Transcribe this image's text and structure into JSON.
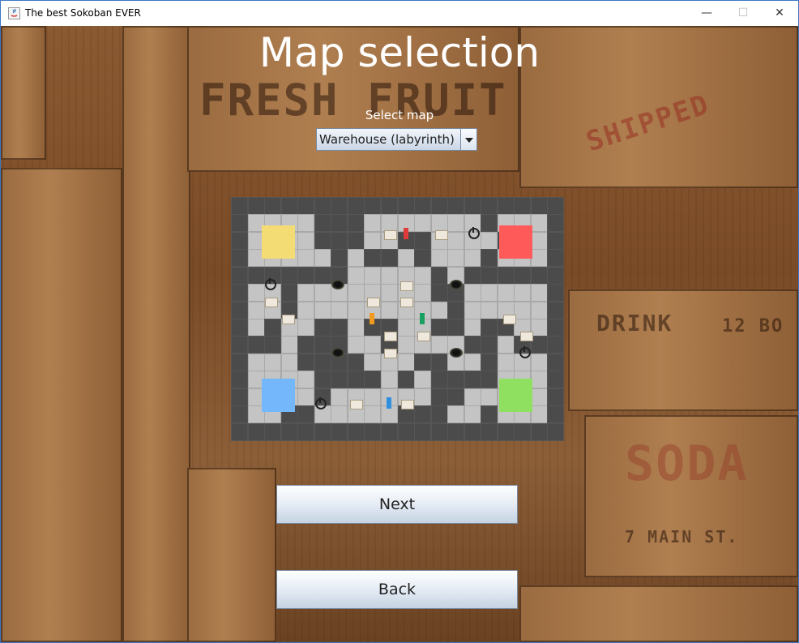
{
  "window": {
    "title": "The best Sokoban EVER"
  },
  "titlebar": {
    "minimize_glyph": "—",
    "maximize_glyph": "☐",
    "close_glyph": "✕"
  },
  "heading": "Map selection",
  "map_select": {
    "label": "Select map",
    "value": "Warehouse (labyrinth)"
  },
  "buttons": {
    "next": "Next",
    "back": "Back"
  },
  "background_text": [
    "FRESH FRUIT",
    "DRINK",
    "12 BO",
    "SODA",
    "7 MAIN ST.",
    "SHIPPED"
  ],
  "goal_colors": {
    "yellow": "#f3dc74",
    "red": "#ff5a5a",
    "blue": "#74b7fa",
    "green": "#8fe060"
  },
  "player_colors": [
    "#e23b3b",
    "#f09a20",
    "#1aa060",
    "#2f8fe0"
  ],
  "map_preview": {
    "cols": 20,
    "rows": 14,
    "grid": [
      "WWWWWWWWWWWWWWWWWWWW",
      "W....WWW.......W...W",
      "W....WWW..WW....W..W",
      "W.....W.WW.W...W...W",
      "WWWWWWW.....W.WWWWWW",
      "W..W........WW.....W",
      "W..W.........W.....W",
      "W.W..WW.WW..WW.WW..W",
      "WWW.WWW..W....WW.WWW",
      "W...WWWW...WW..W...W",
      "W....WWWW.W.WWWW...W",
      "W....W......WW.....W",
      "W..WW.....WWW..W...W",
      "WWWWWWWWWWWWWWWWWWWW"
    ]
  }
}
